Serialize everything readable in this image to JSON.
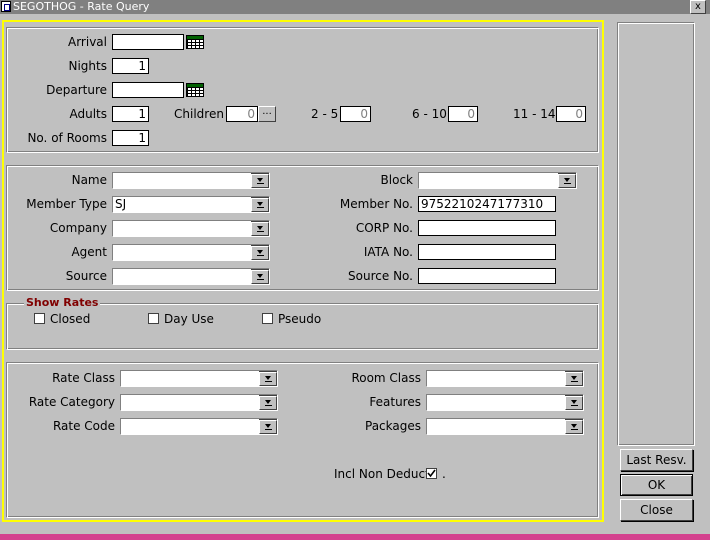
{
  "window": {
    "title": "SEGOTHOG - Rate Query",
    "close_label": "x"
  },
  "stay": {
    "arrival_label": "Arrival",
    "arrival_value": "",
    "nights_label": "Nights",
    "nights_value": "1",
    "departure_label": "Departure",
    "departure_value": "",
    "adults_label": "Adults",
    "adults_value": "1",
    "children_label": "Children",
    "children_value": "0",
    "children_more": "...",
    "age_2_5_label": "2 - 5",
    "age_2_5_value": "0",
    "age_6_10_label": "6 - 10",
    "age_6_10_value": "0",
    "age_11_14_label": "11 - 14",
    "age_11_14_value": "0",
    "rooms_label": "No. of Rooms",
    "rooms_value": "1"
  },
  "profile": {
    "name_label": "Name",
    "name_value": "",
    "member_type_label": "Member Type",
    "member_type_value": "SJ",
    "company_label": "Company",
    "company_value": "",
    "agent_label": "Agent",
    "agent_value": "",
    "source_label": "Source",
    "source_value": "",
    "block_label": "Block",
    "block_value": "",
    "member_no_label": "Member No.",
    "member_no_value": "9752210247177310",
    "corp_no_label": "CORP No.",
    "corp_no_value": "",
    "iata_no_label": "IATA No.",
    "iata_no_value": "",
    "source_no_label": "Source No.",
    "source_no_value": ""
  },
  "show_rates": {
    "legend": "Show Rates",
    "closed_label": "Closed",
    "closed_checked": false,
    "day_use_label": "Day Use",
    "day_use_checked": false,
    "pseudo_label": "Pseudo",
    "pseudo_checked": false
  },
  "rates": {
    "rate_class_label": "Rate Class",
    "rate_class_value": "",
    "rate_category_label": "Rate Category",
    "rate_category_value": "",
    "rate_code_label": "Rate Code",
    "rate_code_value": "",
    "room_class_label": "Room Class",
    "room_class_value": "",
    "features_label": "Features",
    "features_value": "",
    "packages_label": "Packages",
    "packages_value": "",
    "incl_non_deduct_label": "Incl Non Deduct",
    "incl_non_deduct_checked": true,
    "incl_non_deduct_suffix": "."
  },
  "buttons": {
    "last_resv": "Last Resv.",
    "ok": "OK",
    "close": "Close"
  },
  "colors": {
    "accent_yellow": "#ffff00",
    "legend_red": "#800000",
    "bottom_bar": "#d4418e",
    "title_bar": "#808080"
  }
}
